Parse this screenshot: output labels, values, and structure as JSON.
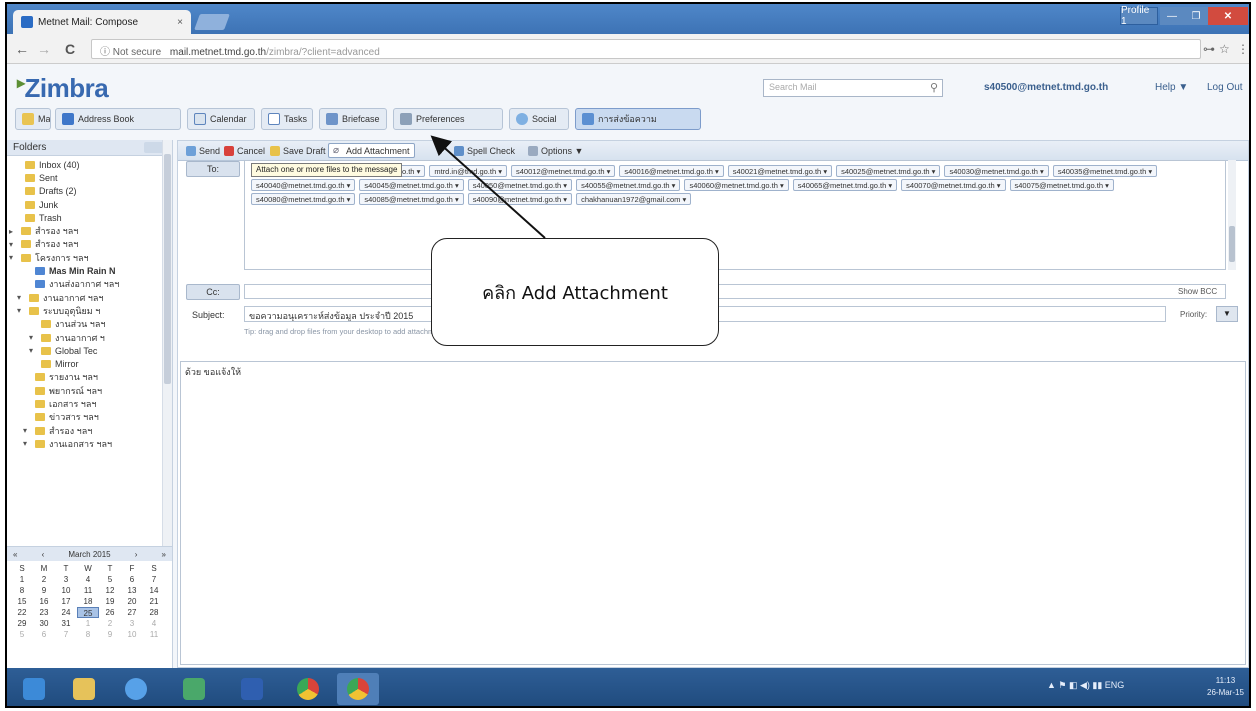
{
  "browser": {
    "tab_title": "Metnet Mail: Compose",
    "tab_close": "×",
    "window_user": "Profile 1",
    "min": "—",
    "max": "❐",
    "close": "✕",
    "security": "ⓘ Not secure",
    "url_host": "mail.metnet.tmd.go.th",
    "url_path": "/zimbra/?client=advanced",
    "back": "←",
    "forward": "→",
    "reload": "C",
    "key_icon": "⊶",
    "star": "☆",
    "menu": "⋮"
  },
  "zimbra": {
    "logo": "Zimbra",
    "search_placeholder": "Search Mail",
    "account": "s40500@metnet.tmd.go.th",
    "help": "Help ▼",
    "logout": "Log Out"
  },
  "app_tabs": [
    {
      "label": "Mail"
    },
    {
      "label": "Address Book"
    },
    {
      "label": "Calendar"
    },
    {
      "label": "Tasks"
    },
    {
      "label": "Briefcase"
    },
    {
      "label": "Preferences"
    },
    {
      "label": "Social"
    },
    {
      "label": "การส่งข้อความ"
    }
  ],
  "sidebar": {
    "header": "Folders",
    "folders": [
      {
        "label": "Inbox (40)",
        "twisty": ""
      },
      {
        "label": "Sent",
        "twisty": ""
      },
      {
        "label": "Drafts (2)",
        "twisty": ""
      },
      {
        "label": "Junk",
        "twisty": ""
      },
      {
        "label": "Trash",
        "twisty": ""
      },
      {
        "label": "สำรอง ฯลฯ",
        "twisty": "▸"
      },
      {
        "label": "สำรอง ฯลฯ",
        "twisty": "▾"
      },
      {
        "label": "โครงการ ฯลฯ",
        "twisty": "▾"
      },
      {
        "label": "Mas Min Rain N",
        "twisty": ""
      },
      {
        "label": "งานส่งอากาศ ฯลฯ",
        "twisty": ""
      },
      {
        "label": "งานอากาศ ฯลฯ",
        "twisty": "▾"
      },
      {
        "label": "ระบบอุตุนิยม ฯ",
        "twisty": "▾"
      },
      {
        "label": "งานส่วน ฯลฯ",
        "twisty": ""
      },
      {
        "label": "งานอากาศ ฯ",
        "twisty": "▾"
      },
      {
        "label": "Global Tec",
        "twisty": "▾"
      },
      {
        "label": "Mirror",
        "twisty": ""
      },
      {
        "label": "รายงาน ฯลฯ",
        "twisty": ""
      },
      {
        "label": "พยากรณ์ ฯลฯ",
        "twisty": ""
      },
      {
        "label": "เอกสาร ฯลฯ",
        "twisty": ""
      },
      {
        "label": "ข่าวสาร ฯลฯ",
        "twisty": ""
      },
      {
        "label": "สำรอง ฯลฯ",
        "twisty": "▾"
      },
      {
        "label": "งานเอกสาร ฯลฯ",
        "twisty": "▾"
      }
    ]
  },
  "calendar": {
    "prev_year": "«",
    "prev": "‹",
    "month": "March 2015",
    "next": "›",
    "next_year": "»",
    "weekdays": [
      "S",
      "M",
      "T",
      "W",
      "T",
      "F",
      "S"
    ],
    "weeks": [
      [
        "1",
        "2",
        "3",
        "4",
        "5",
        "6",
        "7"
      ],
      [
        "8",
        "9",
        "10",
        "11",
        "12",
        "13",
        "14"
      ],
      [
        "15",
        "16",
        "17",
        "18",
        "19",
        "20",
        "21"
      ],
      [
        "22",
        "23",
        "24",
        "25",
        "26",
        "27",
        "28"
      ],
      [
        "29",
        "30",
        "31",
        "1",
        "2",
        "3",
        "4"
      ],
      [
        "5",
        "6",
        "7",
        "8",
        "9",
        "10",
        "11"
      ]
    ]
  },
  "toolbar": {
    "send": "Send",
    "cancel": "Cancel",
    "save_draft": "Save Draft",
    "add_attachment": "Add Attachment",
    "spell_check": "Spell Check",
    "options": "Options ▼",
    "tooltip": "Attach one or more files to the message"
  },
  "compose": {
    "to_button": "To:",
    "cc_button": "Cc:",
    "show_bcc": "Show BCC",
    "subject_label": "Subject:",
    "subject_value": "ขอความอนุเคราะห์ส่งข้อมูล ประจำปี 2015",
    "priority_label": "Priority:",
    "priority_value": "▼",
    "drop_hint": "Tip: drag and drop files from your desktop to add attachments to this message.",
    "body": "ด้วย ขอแจ้งให้",
    "recipients": [
      "rcaalis@tmd.go.th",
      "metnet.com@tmd.go.th",
      "mtrd.in@tmd.go.th",
      "s40012@metnet.tmd.go.th",
      "s40016@metnet.tmd.go.th",
      "s40021@metnet.tmd.go.th",
      "s40025@metnet.tmd.go.th",
      "s40030@metnet.tmd.go.th",
      "s40035@metnet.tmd.go.th",
      "s40040@metnet.tmd.go.th",
      "s40045@metnet.tmd.go.th",
      "s40050@metnet.tmd.go.th",
      "s40055@metnet.tmd.go.th",
      "s40060@metnet.tmd.go.th",
      "s40065@metnet.tmd.go.th",
      "s40070@metnet.tmd.go.th",
      "s40075@metnet.tmd.go.th",
      "s40080@metnet.tmd.go.th",
      "s40085@metnet.tmd.go.th",
      "s40090@metnet.tmd.go.th",
      "chakhanuan1972@gmail.com"
    ]
  },
  "annotation": {
    "callout": "คลิก Add Attachment"
  },
  "taskbar": {
    "tray": "▲ ⚑ ◧ ◀) ▮▮ ENG",
    "time": "11:13",
    "date": "26-Mar-15"
  }
}
